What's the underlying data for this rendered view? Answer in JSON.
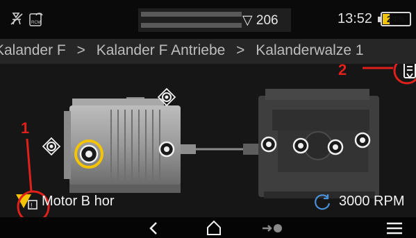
{
  "status_bar": {
    "left_icons": [
      "rotation-lock-icon",
      "device-icon"
    ],
    "count": "▽ 206",
    "time": "13:52",
    "battery_percent": 24,
    "battery_text": "24%",
    "battery_color": "#f1c40f"
  },
  "breadcrumb": {
    "items": [
      "Kalander F",
      "Kalander F Antriebe",
      "Kalanderwalze 1"
    ],
    "separator": ">"
  },
  "annotations": {
    "marker_1": "1",
    "marker_2": "2",
    "annotation_color": "#e0201a"
  },
  "machine": {
    "motor_label": "Motor B hor",
    "speed": "3000 RPM",
    "selected_point_color": "#f5c400"
  },
  "navbar": {
    "icons": [
      "back-icon",
      "home-icon",
      "next-icon",
      "menu-icon"
    ]
  }
}
